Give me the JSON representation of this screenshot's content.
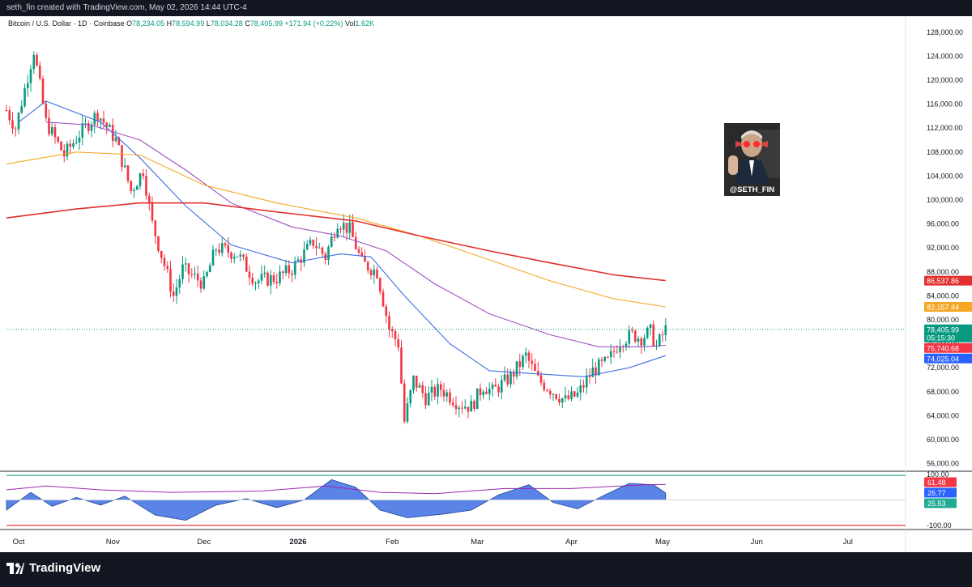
{
  "header": {
    "credit": "seth_fin created with TradingView.com, May 02, 2026 14:44 UTC-4"
  },
  "legend": {
    "symbol": "Bitcoin / U.S. Dollar · 1D · Coinbase",
    "o_label": "O",
    "o": "78,234.05",
    "h_label": "H",
    "h": "78,594.99",
    "l_label": "L",
    "l": "78,034.28",
    "c_label": "C",
    "c": "78,405.99",
    "change": "+171.94 (+0.22%)",
    "vol_label": "Vol",
    "vol": "1.62K"
  },
  "overlay": {
    "handle": "@SETH_FIN"
  },
  "footer": {
    "brand": "TradingView"
  },
  "colors": {
    "up": "#089981",
    "down": "#f23645",
    "ma_blue": "#3d6ee0",
    "ma_purple": "#a050c0",
    "ma_orange": "#f5a623",
    "ma_red": "#e0302f",
    "osc_fill": "#3d6ee0",
    "osc_line": "#9c27b0"
  },
  "chart_data": [
    {
      "type": "candlestick",
      "title": "Bitcoin / U.S. Dollar · 1D · Coinbase",
      "x_axis": {
        "tick_labels": [
          "Oct",
          "Nov",
          "Dec",
          "2026",
          "Feb",
          "Mar",
          "Apr",
          "May",
          "Jun",
          "Jul"
        ],
        "range": [
          "2025-09-27",
          "2026-07-20"
        ]
      },
      "y_axis": {
        "ticks": [
          56000,
          60000,
          64000,
          68000,
          72000,
          76000,
          80000,
          84000,
          88000,
          92000,
          96000,
          100000,
          104000,
          108000,
          112000,
          116000,
          120000,
          124000,
          128000
        ],
        "tick_labels": [
          "56,000.00",
          "60,000.00",
          "64,000.00",
          "68,000.00",
          "72,000.00",
          "76,000.00",
          "80,000.00",
          "84,000.00",
          "88,000.00",
          "92,000.00",
          "96,000.00",
          "100,000.00",
          "104,000.00",
          "108,000.00",
          "112,000.00",
          "116,000.00",
          "120,000.00",
          "124,000.00",
          "128,000.00"
        ],
        "range": [
          55000,
          130000
        ]
      },
      "price_path": [
        [
          "2025-09-27",
          115000
        ],
        [
          "2025-09-30",
          112000
        ],
        [
          "2025-10-06",
          125000
        ],
        [
          "2025-10-10",
          113000
        ],
        [
          "2025-10-16",
          107500
        ],
        [
          "2025-10-21",
          111000
        ],
        [
          "2025-10-27",
          114500
        ],
        [
          "2025-11-02",
          110000
        ],
        [
          "2025-11-07",
          101500
        ],
        [
          "2025-11-11",
          105000
        ],
        [
          "2025-11-14",
          96000
        ],
        [
          "2025-11-21",
          84000
        ],
        [
          "2025-11-24",
          88500
        ],
        [
          "2025-12-01",
          86000
        ],
        [
          "2025-12-05",
          92000
        ],
        [
          "2025-12-12",
          91000
        ],
        [
          "2025-12-18",
          86500
        ],
        [
          "2025-12-25",
          87000
        ],
        [
          "2025-12-30",
          88500
        ],
        [
          "2026-01-06",
          93000
        ],
        [
          "2026-01-10",
          90500
        ],
        [
          "2026-01-14",
          96500
        ],
        [
          "2026-01-18",
          95000
        ],
        [
          "2026-01-22",
          89500
        ],
        [
          "2026-01-27",
          88000
        ],
        [
          "2026-01-31",
          78500
        ],
        [
          "2026-02-03",
          76000
        ],
        [
          "2026-02-05",
          63000
        ],
        [
          "2026-02-08",
          70000
        ],
        [
          "2026-02-12",
          67000
        ],
        [
          "2026-02-17",
          68500
        ],
        [
          "2026-02-23",
          66000
        ],
        [
          "2026-02-27",
          65500
        ],
        [
          "2026-03-03",
          69000
        ],
        [
          "2026-03-06",
          68000
        ],
        [
          "2026-03-12",
          70500
        ],
        [
          "2026-03-17",
          74000
        ],
        [
          "2026-03-21",
          70000
        ],
        [
          "2026-03-26",
          68000
        ],
        [
          "2026-03-30",
          66500
        ],
        [
          "2026-04-03",
          67500
        ],
        [
          "2026-04-08",
          71500
        ],
        [
          "2026-04-13",
          73000
        ],
        [
          "2026-04-17",
          76500
        ],
        [
          "2026-04-21",
          77500
        ],
        [
          "2026-04-24",
          77000
        ],
        [
          "2026-04-27",
          78000
        ],
        [
          "2026-04-29",
          75500
        ],
        [
          "2026-05-02",
          78406
        ]
      ],
      "series": [
        {
          "name": "",
          "color": "#3d6ee0",
          "points": [
            [
              "2025-10-01",
              113000
            ],
            [
              "2025-10-10",
              116500
            ],
            [
              "2025-10-28",
              113000
            ],
            [
              "2025-11-10",
              107000
            ],
            [
              "2025-11-25",
              99000
            ],
            [
              "2025-12-10",
              92500
            ],
            [
              "2025-12-30",
              89500
            ],
            [
              "2026-01-15",
              91000
            ],
            [
              "2026-01-25",
              90500
            ],
            [
              "2026-02-05",
              84000
            ],
            [
              "2026-02-20",
              76000
            ],
            [
              "2026-03-05",
              71500
            ],
            [
              "2026-03-20",
              71000
            ],
            [
              "2026-04-05",
              70500
            ],
            [
              "2026-04-20",
              72000
            ],
            [
              "2026-05-02",
              74025
            ]
          ]
        },
        {
          "name": "",
          "color": "#a050c0",
          "points": [
            [
              "2025-10-10",
              113000
            ],
            [
              "2025-10-25",
              112500
            ],
            [
              "2025-11-10",
              110000
            ],
            [
              "2025-11-25",
              105000
            ],
            [
              "2025-12-10",
              99500
            ],
            [
              "2025-12-30",
              95500
            ],
            [
              "2026-01-15",
              94000
            ],
            [
              "2026-01-30",
              91500
            ],
            [
              "2026-02-15",
              86000
            ],
            [
              "2026-03-05",
              81000
            ],
            [
              "2026-03-25",
              77500
            ],
            [
              "2026-04-10",
              75500
            ],
            [
              "2026-04-25",
              75500
            ],
            [
              "2026-05-02",
              75741
            ]
          ]
        },
        {
          "name": "",
          "color": "#f5a623",
          "points": [
            [
              "2025-09-27",
              106000
            ],
            [
              "2025-10-20",
              108000
            ],
            [
              "2025-11-10",
              107500
            ],
            [
              "2025-12-01",
              102500
            ],
            [
              "2025-12-25",
              99500
            ],
            [
              "2026-01-20",
              97000
            ],
            [
              "2026-02-10",
              94000
            ],
            [
              "2026-03-05",
              90000
            ],
            [
              "2026-03-25",
              86500
            ],
            [
              "2026-04-15",
              83500
            ],
            [
              "2026-05-02",
              82157
            ]
          ]
        },
        {
          "name": "",
          "color": "#e0302f",
          "points": [
            [
              "2025-09-27",
              97000
            ],
            [
              "2025-10-20",
              98500
            ],
            [
              "2025-11-10",
              99500
            ],
            [
              "2025-12-01",
              99500
            ],
            [
              "2025-12-25",
              98000
            ],
            [
              "2026-01-20",
              96500
            ],
            [
              "2026-02-10",
              94000
            ],
            [
              "2026-03-05",
              91500
            ],
            [
              "2026-03-25",
              89500
            ],
            [
              "2026-04-15",
              87500
            ],
            [
              "2026-05-02",
              86538
            ]
          ]
        }
      ],
      "price_labels": [
        {
          "value": 86537.86,
          "text": "86,537.86",
          "color": "#e0302f"
        },
        {
          "value": 82157.44,
          "text": "82,157.44",
          "color": "#f5a623"
        },
        {
          "value": 78405.99,
          "text": "78,405.99",
          "color": "#089981",
          "sub": "05:15:30"
        },
        {
          "value": 75740.68,
          "text": "75,740.68",
          "color": "#f23645"
        },
        {
          "value": 74025.04,
          "text": "74,025.04",
          "color": "#2962ff"
        }
      ],
      "grid": false,
      "legend": "top-left"
    },
    {
      "type": "area",
      "title": "",
      "y_axis": {
        "range": [
          -110,
          110
        ],
        "tick_labels": [
          "100.00",
          "-100.00"
        ],
        "ticks": [
          100,
          -100
        ]
      },
      "last_values": [
        {
          "text": "61.48",
          "color": "#f23645"
        },
        {
          "text": "26.77",
          "color": "#2962ff"
        },
        {
          "text": "25.53",
          "color": "#22ab94"
        }
      ],
      "series": [
        {
          "name": "",
          "color": "#3d6ee0",
          "points": [
            [
              "2025-09-27",
              -40
            ],
            [
              "2025-10-05",
              30
            ],
            [
              "2025-10-12",
              -25
            ],
            [
              "2025-10-20",
              10
            ],
            [
              "2025-10-28",
              -20
            ],
            [
              "2025-11-05",
              15
            ],
            [
              "2025-11-15",
              -60
            ],
            [
              "2025-11-25",
              -80
            ],
            [
              "2025-12-05",
              -20
            ],
            [
              "2025-12-15",
              5
            ],
            [
              "2025-12-25",
              -30
            ],
            [
              "2026-01-03",
              0
            ],
            [
              "2026-01-12",
              80
            ],
            [
              "2026-01-20",
              50
            ],
            [
              "2026-01-28",
              -40
            ],
            [
              "2026-02-06",
              -70
            ],
            [
              "2026-02-18",
              -55
            ],
            [
              "2026-02-27",
              -40
            ],
            [
              "2026-03-08",
              20
            ],
            [
              "2026-03-18",
              60
            ],
            [
              "2026-03-26",
              -10
            ],
            [
              "2026-04-03",
              -35
            ],
            [
              "2026-04-12",
              20
            ],
            [
              "2026-04-20",
              65
            ],
            [
              "2026-04-28",
              60
            ],
            [
              "2026-05-02",
              27
            ]
          ]
        },
        {
          "name": "",
          "color": "#9c27b0",
          "points": [
            [
              "2025-09-27",
              40
            ],
            [
              "2025-10-10",
              55
            ],
            [
              "2025-10-28",
              40
            ],
            [
              "2025-11-20",
              30
            ],
            [
              "2025-12-20",
              35
            ],
            [
              "2026-01-10",
              55
            ],
            [
              "2026-01-28",
              30
            ],
            [
              "2026-02-15",
              25
            ],
            [
              "2026-03-10",
              45
            ],
            [
              "2026-04-01",
              45
            ],
            [
              "2026-04-25",
              60
            ],
            [
              "2026-05-02",
              61
            ]
          ]
        }
      ]
    }
  ]
}
